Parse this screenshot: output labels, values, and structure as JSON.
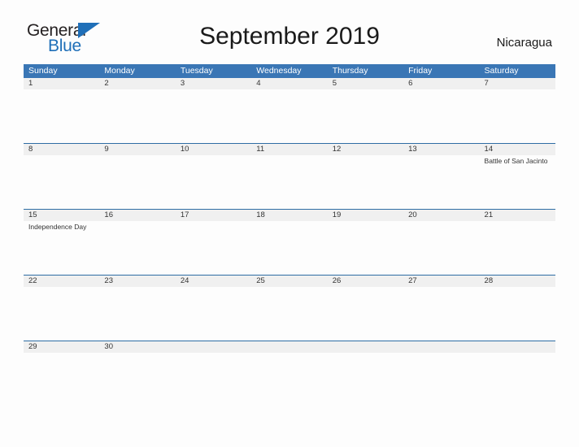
{
  "brand": {
    "name_part1": "General",
    "name_part2": "Blue",
    "flag_icon": "flag-triangle-icon",
    "accent_color": "#1f6fb8"
  },
  "header": {
    "title": "September 2019",
    "country": "Nicaragua"
  },
  "theme": {
    "header_blue": "#3a76b5",
    "separator_blue": "#2e6da4",
    "date_band_gray": "#f0f0f0",
    "page_background": "#fdfdfd",
    "text_color": "#333333"
  },
  "calendar": {
    "weekday_headers": [
      "Sunday",
      "Monday",
      "Tuesday",
      "Wednesday",
      "Thursday",
      "Friday",
      "Saturday"
    ],
    "weeks": [
      {
        "days": [
          {
            "date": "1",
            "event": ""
          },
          {
            "date": "2",
            "event": ""
          },
          {
            "date": "3",
            "event": ""
          },
          {
            "date": "4",
            "event": ""
          },
          {
            "date": "5",
            "event": ""
          },
          {
            "date": "6",
            "event": ""
          },
          {
            "date": "7",
            "event": ""
          }
        ]
      },
      {
        "days": [
          {
            "date": "8",
            "event": ""
          },
          {
            "date": "9",
            "event": ""
          },
          {
            "date": "10",
            "event": ""
          },
          {
            "date": "11",
            "event": ""
          },
          {
            "date": "12",
            "event": ""
          },
          {
            "date": "13",
            "event": ""
          },
          {
            "date": "14",
            "event": "Battle of San Jacinto"
          }
        ]
      },
      {
        "days": [
          {
            "date": "15",
            "event": "Independence Day"
          },
          {
            "date": "16",
            "event": ""
          },
          {
            "date": "17",
            "event": ""
          },
          {
            "date": "18",
            "event": ""
          },
          {
            "date": "19",
            "event": ""
          },
          {
            "date": "20",
            "event": ""
          },
          {
            "date": "21",
            "event": ""
          }
        ]
      },
      {
        "days": [
          {
            "date": "22",
            "event": ""
          },
          {
            "date": "23",
            "event": ""
          },
          {
            "date": "24",
            "event": ""
          },
          {
            "date": "25",
            "event": ""
          },
          {
            "date": "26",
            "event": ""
          },
          {
            "date": "27",
            "event": ""
          },
          {
            "date": "28",
            "event": ""
          }
        ]
      },
      {
        "days": [
          {
            "date": "29",
            "event": ""
          },
          {
            "date": "30",
            "event": ""
          },
          {
            "date": "",
            "event": ""
          },
          {
            "date": "",
            "event": ""
          },
          {
            "date": "",
            "event": ""
          },
          {
            "date": "",
            "event": ""
          },
          {
            "date": "",
            "event": ""
          }
        ]
      }
    ]
  }
}
